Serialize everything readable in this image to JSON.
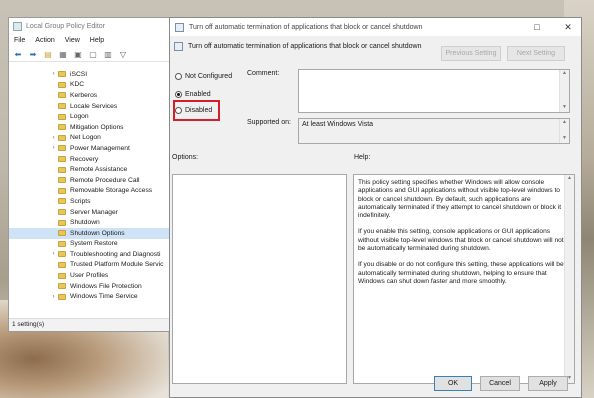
{
  "gpe": {
    "title": "Local Group Policy Editor",
    "menu": [
      "File",
      "Action",
      "View",
      "Help"
    ],
    "tree": [
      {
        "label": "iSCSI",
        "expandable": true
      },
      {
        "label": "KDC",
        "expandable": false
      },
      {
        "label": "Kerberos",
        "expandable": false
      },
      {
        "label": "Locale Services",
        "expandable": false
      },
      {
        "label": "Logon",
        "expandable": false
      },
      {
        "label": "Mitigation Options",
        "expandable": false
      },
      {
        "label": "Net Logon",
        "expandable": true
      },
      {
        "label": "Power Management",
        "expandable": true
      },
      {
        "label": "Recovery",
        "expandable": false
      },
      {
        "label": "Remote Assistance",
        "expandable": false
      },
      {
        "label": "Remote Procedure Call",
        "expandable": false
      },
      {
        "label": "Removable Storage Access",
        "expandable": false
      },
      {
        "label": "Scripts",
        "expandable": false
      },
      {
        "label": "Server Manager",
        "expandable": false
      },
      {
        "label": "Shutdown",
        "expandable": false
      },
      {
        "label": "Shutdown Options",
        "expandable": false,
        "selected": true
      },
      {
        "label": "System Restore",
        "expandable": false
      },
      {
        "label": "Troubleshooting and Diagnosti",
        "expandable": true
      },
      {
        "label": "Trusted Platform Module Servic",
        "expandable": false
      },
      {
        "label": "User Profiles",
        "expandable": false
      },
      {
        "label": "Windows File Protection",
        "expandable": false
      },
      {
        "label": "Windows Time Service",
        "expandable": true
      }
    ],
    "status": "1 setting(s)"
  },
  "dialog": {
    "title": "Turn off automatic termination of applications that block or cancel shutdown",
    "header": "Turn off automatic termination of applications that block or cancel shutdown",
    "previous_setting": "Previous Setting",
    "next_setting": "Next Setting",
    "radio_not_configured": "Not Configured",
    "radio_enabled": "Enabled",
    "radio_disabled": "Disabled",
    "selected_option": "Enabled",
    "comment_label": "Comment:",
    "comment_value": "",
    "supported_label": "Supported on:",
    "supported_value": "At least Windows Vista",
    "options_label": "Options:",
    "help_label": "Help:",
    "help_paragraphs": [
      "This policy setting specifies whether Windows will allow console applications and GUI applications without visible top-level windows to block or cancel shutdown. By default, such applications are automatically terminated if they attempt to cancel shutdown or block it indefinitely.",
      "If you enable this setting, console applications or GUI applications without visible top-level windows that block or cancel shutdown will not be automatically terminated during shutdown.",
      "If you disable or do not configure this setting, these applications will be automatically terminated during shutdown, helping to ensure that Windows can shut down faster and more smoothly."
    ],
    "ok": "OK",
    "cancel": "Cancel",
    "apply": "Apply"
  }
}
